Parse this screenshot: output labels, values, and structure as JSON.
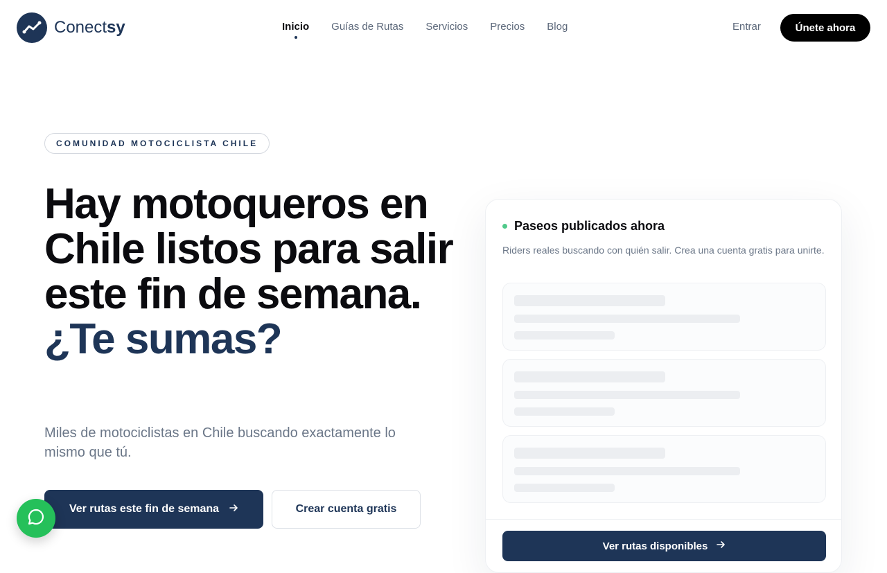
{
  "brand": {
    "name_regular": "Conect",
    "name_bold": "sy",
    "color": "#1e3557"
  },
  "nav": {
    "items": [
      {
        "label": "Inicio",
        "active": true
      },
      {
        "label": "Guías de Rutas"
      },
      {
        "label": "Servicios"
      },
      {
        "label": "Precios"
      },
      {
        "label": "Blog"
      }
    ],
    "login": "Entrar",
    "join": "Únete ahora"
  },
  "hero": {
    "badge": "COMUNIDAD MOTOCICLISTA CHILE",
    "title_main": "Hay motoqueros en Chile listos para salir este fin de semana.",
    "title_accent": "¿Te sumas?",
    "subtitle": "Miles de motociclistas en Chile buscando exactamente lo mismo que tú.",
    "primary_cta": "Ver rutas este fin de semana",
    "secondary_cta": "Crear cuenta gratis"
  },
  "card": {
    "title": "Paseos publicados ahora",
    "description": "Riders reales buscando con quién salir. Crea una cuenta gratis para unirte.",
    "cta": "Ver rutas disponibles",
    "status_color": "#4fc98a"
  },
  "icons": {
    "logo": "trend-line-icon",
    "arrow": "arrow-right-icon",
    "whatsapp": "whatsapp-icon"
  }
}
